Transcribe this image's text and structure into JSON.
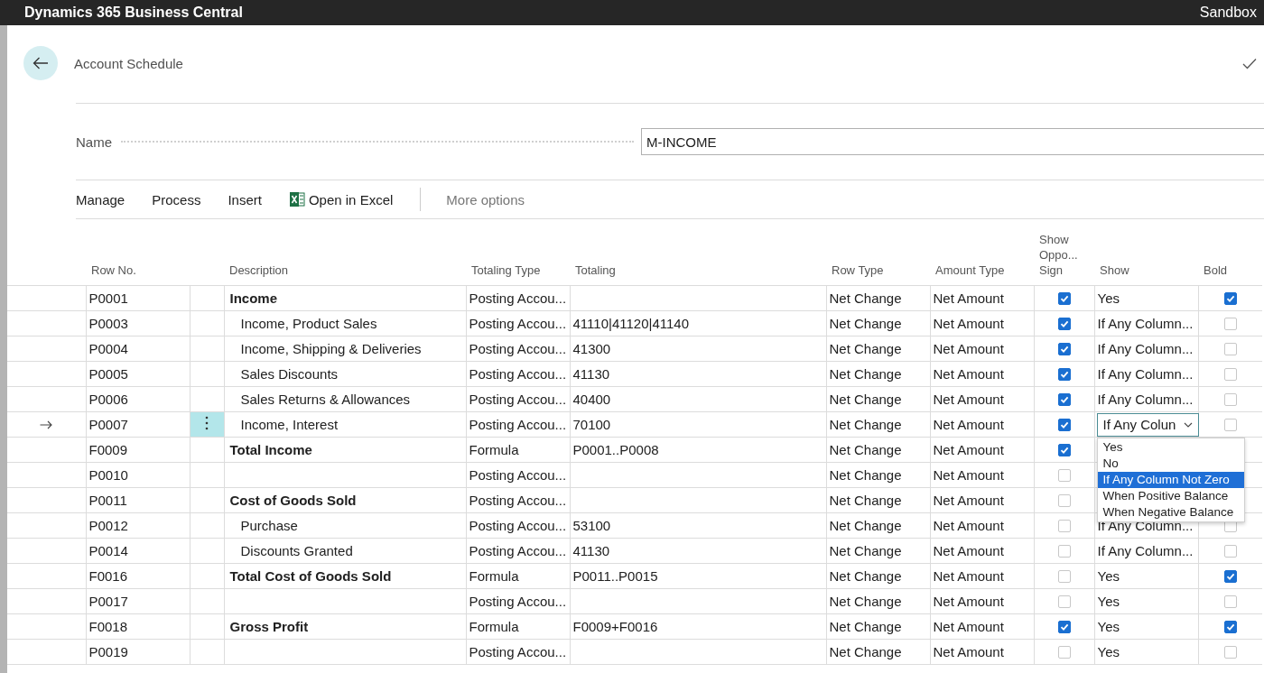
{
  "header": {
    "app_title": "Dynamics 365 Business Central",
    "environment": "Sandbox"
  },
  "page": {
    "title": "Account Schedule"
  },
  "name_field": {
    "label": "Name",
    "value": "M-INCOME"
  },
  "actions": [
    {
      "label": "Manage",
      "kind": "menu"
    },
    {
      "label": "Process",
      "kind": "menu"
    },
    {
      "label": "Insert",
      "kind": "menu"
    },
    {
      "label": "Open in Excel",
      "kind": "excel"
    },
    {
      "label": "More options",
      "kind": "more"
    }
  ],
  "table": {
    "columns": [
      {
        "label": "Row No."
      },
      {
        "label": "Description"
      },
      {
        "label": "Totaling Type"
      },
      {
        "label": "Totaling"
      },
      {
        "label": "Row Type"
      },
      {
        "label": "Amount Type"
      },
      {
        "label": "Show Oppo... Sign"
      },
      {
        "label": "Show"
      },
      {
        "label": "Bold"
      }
    ],
    "rows": [
      {
        "row_no": "P0001",
        "description": "Income",
        "kind": "heading",
        "totaling_type": "Posting Accou...",
        "row_type": "Net Change",
        "amount_type": "Net Amount",
        "show_opposite_sign": true,
        "show": "Yes",
        "bold": true,
        "selected": false,
        "show_open": false
      },
      {
        "row_no": "P0003",
        "description": "Income, Product Sales",
        "kind": "detail",
        "totaling_type": "Posting Accou...",
        "totaling": "41110|41120|41140",
        "row_type": "Net Change",
        "amount_type": "Net Amount",
        "show_opposite_sign": true,
        "show": "If Any Column...",
        "bold": false,
        "selected": false,
        "show_open": false
      },
      {
        "row_no": "P0004",
        "description": "Income, Shipping & Deliveries",
        "kind": "detail",
        "totaling_type": "Posting Accou...",
        "totaling": "41300",
        "row_type": "Net Change",
        "amount_type": "Net Amount",
        "show_opposite_sign": true,
        "show": "If Any Column...",
        "bold": false,
        "selected": false,
        "show_open": false
      },
      {
        "row_no": "P0005",
        "description": "Sales Discounts",
        "kind": "detail",
        "totaling_type": "Posting Accou...",
        "totaling": "41130",
        "row_type": "Net Change",
        "amount_type": "Net Amount",
        "show_opposite_sign": true,
        "show": "If Any Column...",
        "bold": false,
        "selected": false,
        "show_open": false
      },
      {
        "row_no": "P0006",
        "description": "Sales Returns & Allowances",
        "kind": "detail",
        "totaling_type": "Posting Accou...",
        "totaling": "40400",
        "row_type": "Net Change",
        "amount_type": "Net Amount",
        "show_opposite_sign": true,
        "show": "If Any Column...",
        "bold": false,
        "selected": false,
        "show_open": false
      },
      {
        "row_no": "P0007",
        "description": "Income, Interest",
        "kind": "detail",
        "totaling_type": "Posting Accou...",
        "totaling": "70100",
        "row_type": "Net Change",
        "amount_type": "Net Amount",
        "show_opposite_sign": true,
        "show": "If Any Colun",
        "bold": false,
        "selected": true,
        "show_open": true
      },
      {
        "row_no": "F0009",
        "description": "Total Income",
        "kind": "heading",
        "totaling_type": "Formula",
        "totaling": "P0001..P0008",
        "row_type": "Net Change",
        "amount_type": "Net Amount",
        "show_opposite_sign": true,
        "selected": false,
        "show_open": false
      },
      {
        "row_no": "P0010",
        "totaling_type": "Posting Accou...",
        "row_type": "Net Change",
        "amount_type": "Net Amount",
        "show_opposite_sign": false,
        "selected": false,
        "show_open": false
      },
      {
        "row_no": "P0011",
        "description": "Cost of Goods Sold",
        "kind": "heading",
        "totaling_type": "Posting Accou...",
        "row_type": "Net Change",
        "amount_type": "Net Amount",
        "show_opposite_sign": false,
        "selected": false,
        "show_open": false
      },
      {
        "row_no": "P0012",
        "description": "Purchase",
        "kind": "detail",
        "totaling_type": "Posting Accou...",
        "totaling": "53100",
        "row_type": "Net Change",
        "amount_type": "Net Amount",
        "show_opposite_sign": false,
        "show": "If Any Column...",
        "bold": false,
        "selected": false,
        "show_open": false
      },
      {
        "row_no": "P0014",
        "description": "Discounts Granted",
        "kind": "detail",
        "totaling_type": "Posting Accou...",
        "totaling": "41130",
        "row_type": "Net Change",
        "amount_type": "Net Amount",
        "show_opposite_sign": false,
        "show": "If Any Column...",
        "bold": false,
        "selected": false,
        "show_open": false
      },
      {
        "row_no": "F0016",
        "description": "Total Cost of Goods Sold",
        "kind": "heading",
        "totaling_type": "Formula",
        "totaling": "P0011..P0015",
        "row_type": "Net Change",
        "amount_type": "Net Amount",
        "show_opposite_sign": false,
        "show": "Yes",
        "bold": true,
        "selected": false,
        "show_open": false
      },
      {
        "row_no": "P0017",
        "totaling_type": "Posting Accou...",
        "row_type": "Net Change",
        "amount_type": "Net Amount",
        "show_opposite_sign": false,
        "show": "Yes",
        "bold": false,
        "selected": false,
        "show_open": false
      },
      {
        "row_no": "F0018",
        "description": "Gross Profit",
        "kind": "heading",
        "totaling_type": "Formula",
        "totaling": "F0009+F0016",
        "row_type": "Net Change",
        "amount_type": "Net Amount",
        "show_opposite_sign": true,
        "show": "Yes",
        "bold": true,
        "selected": false,
        "show_open": false
      },
      {
        "row_no": "P0019",
        "totaling_type": "Posting Accou...",
        "row_type": "Net Change",
        "amount_type": "Net Amount",
        "show_opposite_sign": false,
        "show": "Yes",
        "bold": false,
        "selected": false,
        "show_open": false
      }
    ]
  },
  "dropdown": {
    "options": [
      {
        "label": "Yes",
        "selected": false
      },
      {
        "label": "No",
        "selected": false
      },
      {
        "label": "If Any Column Not Zero",
        "selected": true
      },
      {
        "label": "When Positive Balance",
        "selected": false
      },
      {
        "label": "When Negative Balance",
        "selected": false
      }
    ]
  }
}
